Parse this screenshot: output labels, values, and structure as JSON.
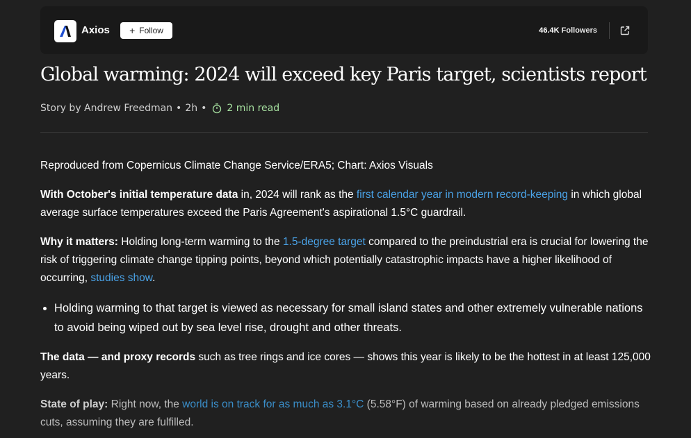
{
  "header": {
    "publisher": "Axios",
    "follow_label": "Follow",
    "followers_count": "46.4K",
    "followers_label": "Followers"
  },
  "article": {
    "title": "Global warming: 2024 will exceed key Paris target, scientists report",
    "byline": "Story by Andrew Freedman",
    "age": "2h",
    "read_time": "2 min read",
    "caption": "Reproduced from Copernicus Climate Change Service/ERA5; Chart: Axios Visuals",
    "p1": {
      "bold": "With October's initial temperature data",
      "t1": " in, 2024 will rank as the ",
      "link": "first calendar year in modern record-keeping",
      "t2": " in which global average surface temperatures exceed the Paris Agreement's aspirational 1.5°C guardrail."
    },
    "p2": {
      "bold": "Why it matters:",
      "t1": " Holding long-term warming to the ",
      "link1": "1.5-degree target",
      "t2": " compared to the preindustrial era is crucial for lowering the risk of triggering climate change tipping points, beyond which potentially catastrophic impacts have a higher likelihood of occurring, ",
      "link2": "studies show",
      "t3": "."
    },
    "bullet1": "Holding warming to that target is viewed as necessary for small island states and other extremely vulnerable nations to avoid being wiped out by sea level rise, drought and other threats.",
    "p3": {
      "bold": "The data — and proxy records",
      "t1": " such as tree rings and ice cores — shows this year is likely to be the hottest in at least 125,000 years."
    },
    "p4": {
      "bold": "State of play:",
      "t1": " Right now, the ",
      "link": "world is on track for as much as 3.1°C",
      "t2": " (5.58°F) of warming based on already pledged emissions cuts, assuming they are fulfilled."
    }
  },
  "colors": {
    "background": "#202020",
    "card": "#191919",
    "link": "#4aa3e8",
    "read_time": "#a6e0a0"
  },
  "icons": [
    "axios-logo-icon",
    "plus-icon",
    "external-link-icon",
    "timer-icon"
  ]
}
